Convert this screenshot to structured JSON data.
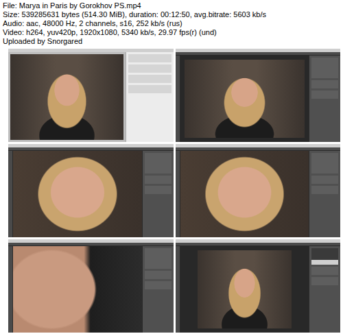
{
  "header": {
    "lines": [
      "File: Marya in Paris by Gorokhov PS.mp4",
      "Size: 539285631 bytes (514.30 MiB), duration: 00:12:50, avg.bitrate: 5603 kb/s",
      "Audio: aac, 48000 Hz, 2 channels, s16, 252 kb/s (rus)",
      "Video: h264, yuv420p, 1920x1080, 5340 kb/s, 29.97 fps(r) (und)",
      "Uploaded by Snorgared"
    ]
  }
}
